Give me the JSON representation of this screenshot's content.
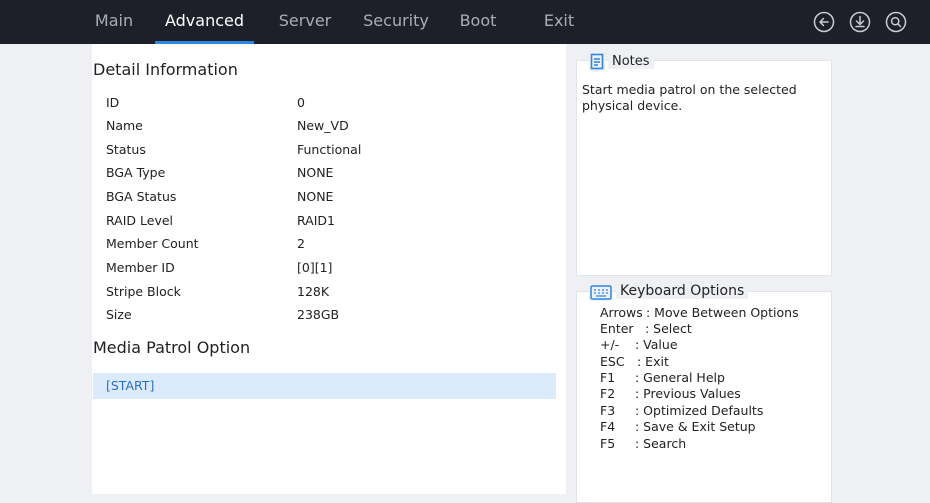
{
  "tabs": [
    "Main",
    "Advanced",
    "Server",
    "Security",
    "Boot",
    "Exit"
  ],
  "active_tab": "Advanced",
  "top_icons": [
    "back-icon",
    "download-icon",
    "search-icon"
  ],
  "detail": {
    "title": "Detail Information",
    "rows": [
      {
        "label": "ID",
        "value": "0"
      },
      {
        "label": "Name",
        "value": "New_VD"
      },
      {
        "label": "Status",
        "value": "Functional"
      },
      {
        "label": "BGA Type",
        "value": "NONE"
      },
      {
        "label": "BGA Status",
        "value": "NONE"
      },
      {
        "label": "RAID Level",
        "value": "RAID1"
      },
      {
        "label": "Member Count",
        "value": "2"
      },
      {
        "label": "Member ID",
        "value": "[0][1]"
      },
      {
        "label": "Stripe Block",
        "value": "128K"
      },
      {
        "label": "Size",
        "value": "238GB"
      }
    ]
  },
  "patrol": {
    "title": "Media Patrol Option",
    "option": "[START]"
  },
  "notes": {
    "title": "Notes",
    "text": "Start media patrol on the selected physical device."
  },
  "keyboard": {
    "title": "Keyboard Options",
    "lines": [
      {
        "key": "Arrows",
        "desc": ": Move Between Options"
      },
      {
        "key": "Enter",
        "desc": ": Select"
      },
      {
        "key": "+/-",
        "desc": ": Value"
      },
      {
        "key": "ESC",
        "desc": ": Exit"
      },
      {
        "key": "F1",
        "desc": ": General Help"
      },
      {
        "key": "F2",
        "desc": ": Previous Values"
      },
      {
        "key": "F3",
        "desc": ": Optimized Defaults"
      },
      {
        "key": "F4",
        "desc": ": Save & Exit Setup"
      },
      {
        "key": "F5",
        "desc": ": Search"
      }
    ]
  },
  "colors": {
    "topbar": "#1d2029",
    "accent": "#2f86e0",
    "selected_row": "#dcebfb",
    "selected_text": "#2a6fc7"
  }
}
